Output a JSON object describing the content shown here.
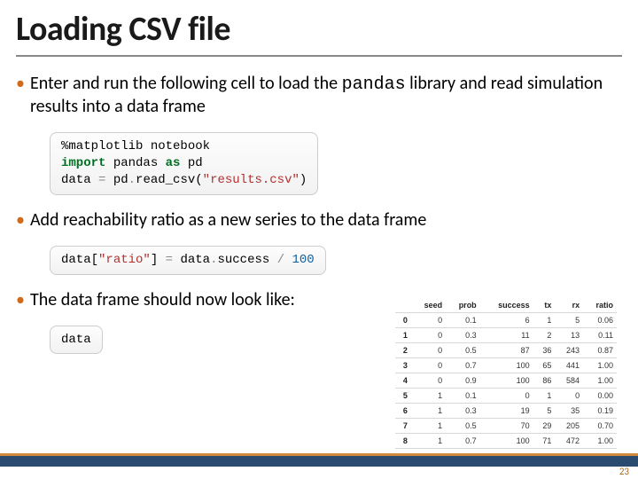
{
  "title": "Loading CSV file",
  "bullets": {
    "b1a": "Enter and run the following cell to load the ",
    "b1b": "pandas",
    "b1c": " library and read simulation results into a data frame",
    "b2": "Add reachability ratio as a new series to the data frame",
    "b3": "The data frame should now look like:"
  },
  "code": {
    "c1_line1": "%matplotlib notebook",
    "c1_kw_import": "import",
    "c1_pandas": " pandas ",
    "c1_kw_as": "as",
    "c1_pd": " pd",
    "c1_line3a": "data ",
    "c1_eq": "=",
    "c1_line3b": " pd",
    "c1_dot": ".",
    "c1_line3c": "read_csv(",
    "c1_str": "\"results.csv\"",
    "c1_line3d": ")",
    "c2a": "data[",
    "c2_str1": "\"ratio\"",
    "c2b": "] ",
    "c2_eq": "=",
    "c2c": " data",
    "c2_dot": ".",
    "c2d": "success ",
    "c2_slash": "/",
    "c2_sp": " ",
    "c2_num": "100",
    "c3": "data"
  },
  "table": {
    "headers": [
      "",
      "seed",
      "prob",
      "success",
      "tx",
      "rx",
      "ratio"
    ],
    "rows": [
      [
        "0",
        "0",
        "0.1",
        "6",
        "1",
        "5",
        "0.06"
      ],
      [
        "1",
        "0",
        "0.3",
        "11",
        "2",
        "13",
        "0.11"
      ],
      [
        "2",
        "0",
        "0.5",
        "87",
        "36",
        "243",
        "0.87"
      ],
      [
        "3",
        "0",
        "0.7",
        "100",
        "65",
        "441",
        "1.00"
      ],
      [
        "4",
        "0",
        "0.9",
        "100",
        "86",
        "584",
        "1.00"
      ],
      [
        "5",
        "1",
        "0.1",
        "0",
        "1",
        "0",
        "0.00"
      ],
      [
        "6",
        "1",
        "0.3",
        "19",
        "5",
        "35",
        "0.19"
      ],
      [
        "7",
        "1",
        "0.5",
        "70",
        "29",
        "205",
        "0.70"
      ],
      [
        "8",
        "1",
        "0.7",
        "100",
        "71",
        "472",
        "1.00"
      ]
    ]
  },
  "pagenum": "23"
}
